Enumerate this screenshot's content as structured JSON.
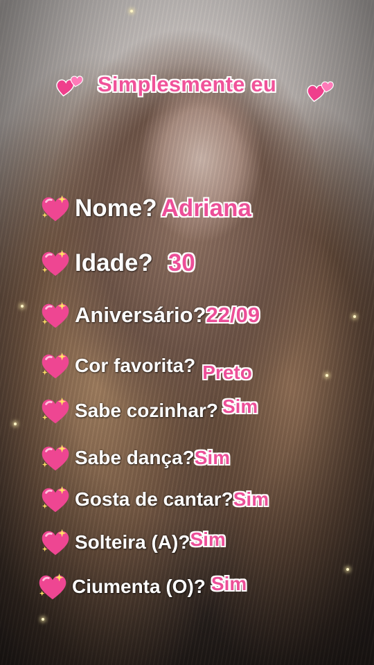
{
  "title": "Simplesmente eu",
  "questions": [
    {
      "q": "Nome?",
      "a": "Adriana"
    },
    {
      "q": "Idade?",
      "a": "30"
    },
    {
      "q": "Aniversário?",
      "a": "22/09"
    },
    {
      "q": "Cor favorita?",
      "a": "Preto"
    },
    {
      "q": "Sabe cozinhar?",
      "a": "Sim"
    },
    {
      "q": "Sabe dança?",
      "a": "Sim"
    },
    {
      "q": "Gosta de cantar?",
      "a": "Sim"
    },
    {
      "q": "Solteira (A)?",
      "a": "Sim"
    },
    {
      "q": "Ciumenta (O)?",
      "a": "Sim"
    }
  ],
  "icons": {
    "title_icon": "two-hearts-icon",
    "row_icon": "sparkling-heart-icon"
  },
  "colors": {
    "answer_pink": "#ec4f98",
    "question_white": "#ffffff"
  }
}
